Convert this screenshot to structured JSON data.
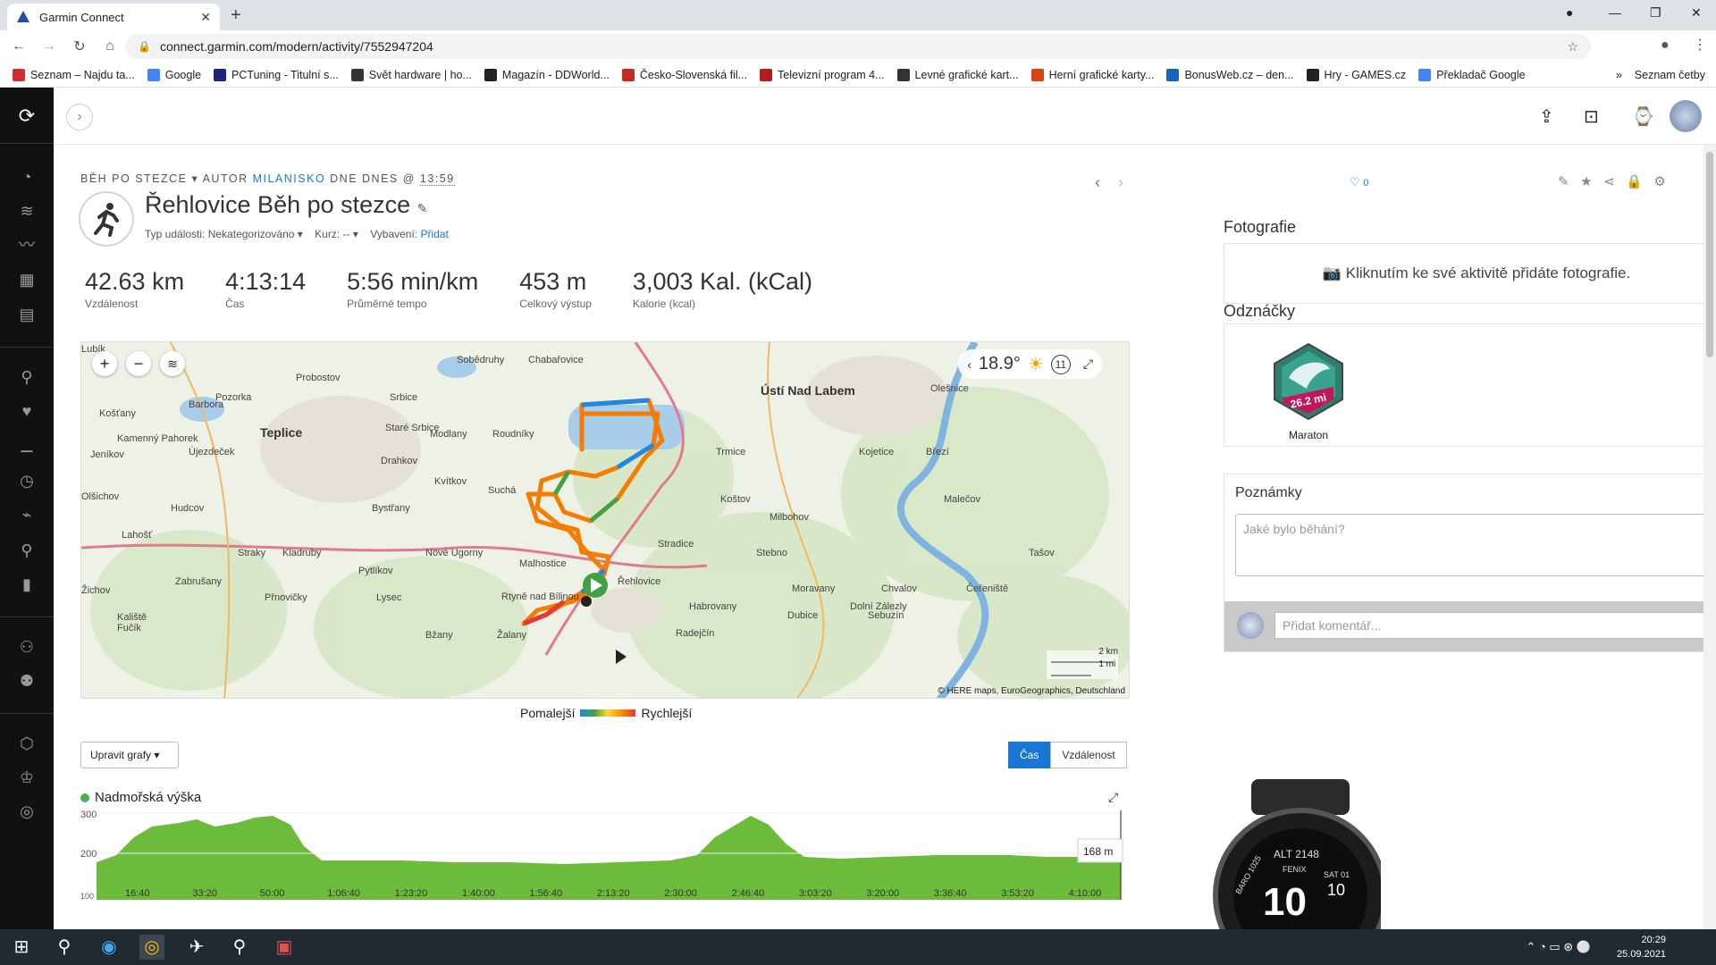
{
  "browser": {
    "tab_title": "Garmin Connect",
    "url": "connect.garmin.com/modern/activity/7552947204",
    "bookmarks": [
      {
        "label": "Seznam – Najdu ta...",
        "color": "#d32f2f"
      },
      {
        "label": "Google",
        "color": "#4285f4"
      },
      {
        "label": "PCTuning - Titulní s...",
        "color": "#1a237e"
      },
      {
        "label": "Svět hardware | ho...",
        "color": "#333"
      },
      {
        "label": "Magazín - DDWorld...",
        "color": "#222"
      },
      {
        "label": "Česko-Slovenská fil...",
        "color": "#c62828"
      },
      {
        "label": "Televizní program 4...",
        "color": "#b71c1c"
      },
      {
        "label": "Levné grafické kart...",
        "color": "#333"
      },
      {
        "label": "Herní grafické karty...",
        "color": "#d84315"
      },
      {
        "label": "BonusWeb.cz – den...",
        "color": "#1565c0"
      },
      {
        "label": "Hry - GAMES.cz",
        "color": "#222"
      },
      {
        "label": "Překladač Google",
        "color": "#4285f4"
      }
    ],
    "reading_list": "Seznam četby"
  },
  "activity": {
    "breadcrumb_type": "Běh po stezce",
    "breadcrumb_author_prefix": "Autor",
    "breadcrumb_author": "milanisko",
    "breadcrumb_date": "dne Dnes @",
    "breadcrumb_time": "13:59",
    "title": "Řehlovice Běh po stezce",
    "event_type_label": "Typ události:",
    "event_type_value": "Nekategorizováno",
    "course_label": "Kurz:",
    "course_value": "--",
    "gear_label": "Vybavení:",
    "gear_value": "Přidat",
    "likes": "0"
  },
  "stats": [
    {
      "value": "42.63 km",
      "label": "Vzdálenost"
    },
    {
      "value": "4:13:14",
      "label": "Čas"
    },
    {
      "value": "5:56 min/km",
      "label": "Průměrné tempo"
    },
    {
      "value": "453 m",
      "label": "Celkový výstup"
    },
    {
      "value": "3,003 Kal. (kCal)",
      "label": "Kalorie (kcal)"
    }
  ],
  "map": {
    "temperature": "18.9°",
    "wind": "11",
    "scale_km": "2 km",
    "scale_mi": "1 mi",
    "attribution": "© HERE maps, EuroGeographics, Deutschland",
    "places": [
      "Sobědruhy",
      "Chabařovice",
      "Ústí Nad Labem",
      "Olešnice",
      "Probostov",
      "Pozorka",
      "Srbice",
      "Teplice",
      "Košťany",
      "Kamenný Pahorek",
      "Újezdeček",
      "Staré Srbice",
      "Modlany",
      "Roudníky",
      "Trmice",
      "Kojetice",
      "Březí",
      "Drahkov",
      "Kvítkov",
      "Suchá",
      "Koštov",
      "Milbohov",
      "Malečov",
      "Hudcov",
      "Bystřany",
      "Lahošť",
      "Stradice",
      "Stebno",
      "Tašov",
      "Straky",
      "Kladruby",
      "Nové Ugorny",
      "Malhostice",
      "Řehlovice",
      "Pytlíkov",
      "Zabrušany",
      "Přnovičky",
      "Lysec",
      "Moravany",
      "Chvalov",
      "Čeřeniště",
      "Habrovany",
      "Dubice",
      "Dolní Zálezly",
      "Sebuzín",
      "Radejčín",
      "Bžany",
      "Žalany",
      "Rtyně nad Bílinou",
      "Kaliště",
      "Fučík",
      "Žichov",
      "Olšichov",
      "Jeníkov",
      "Barbora",
      "Lubík"
    ],
    "legend_slow": "Pomalejší",
    "legend_fast": "Rychlejší"
  },
  "graphs": {
    "edit_label": "Upravit grafy ▾",
    "toggle_time": "Čas",
    "toggle_distance": "Vzdálenost",
    "elevation_title": "Nadmořská výška",
    "y_ticks": [
      "300",
      "200",
      "100"
    ],
    "x_ticks": [
      "16:40",
      "33:20",
      "50:00",
      "1:06:40",
      "1:23:20",
      "1:40:00",
      "1:56:40",
      "2:13:20",
      "2:30:00",
      "2:46:40",
      "3:03:20",
      "3:20:00",
      "3:36:40",
      "3:53:20",
      "4:10:00"
    ],
    "tooltip": "168 m",
    "color": "#6dbb3a"
  },
  "side": {
    "photos_title": "Fotografie",
    "photos_cta": "Kliknutím ke své aktivitě přidáte fotografie.",
    "badges_title": "Odznáčky",
    "badge_label": "Maraton",
    "badge_text": "26.2 mi",
    "notes_title": "Poznámky",
    "notes_placeholder": "Jaké bylo běhání?",
    "comment_placeholder": "Přidat komentář...",
    "watch_brand": "FENIX",
    "watch_time": "10",
    "watch_seconds": "10",
    "watch_alt": "ALT 2148",
    "watch_baro": "BARO 1025",
    "watch_day": "SAT 01"
  },
  "taskbar": {
    "time": "20:29",
    "date": "25.09.2021"
  }
}
